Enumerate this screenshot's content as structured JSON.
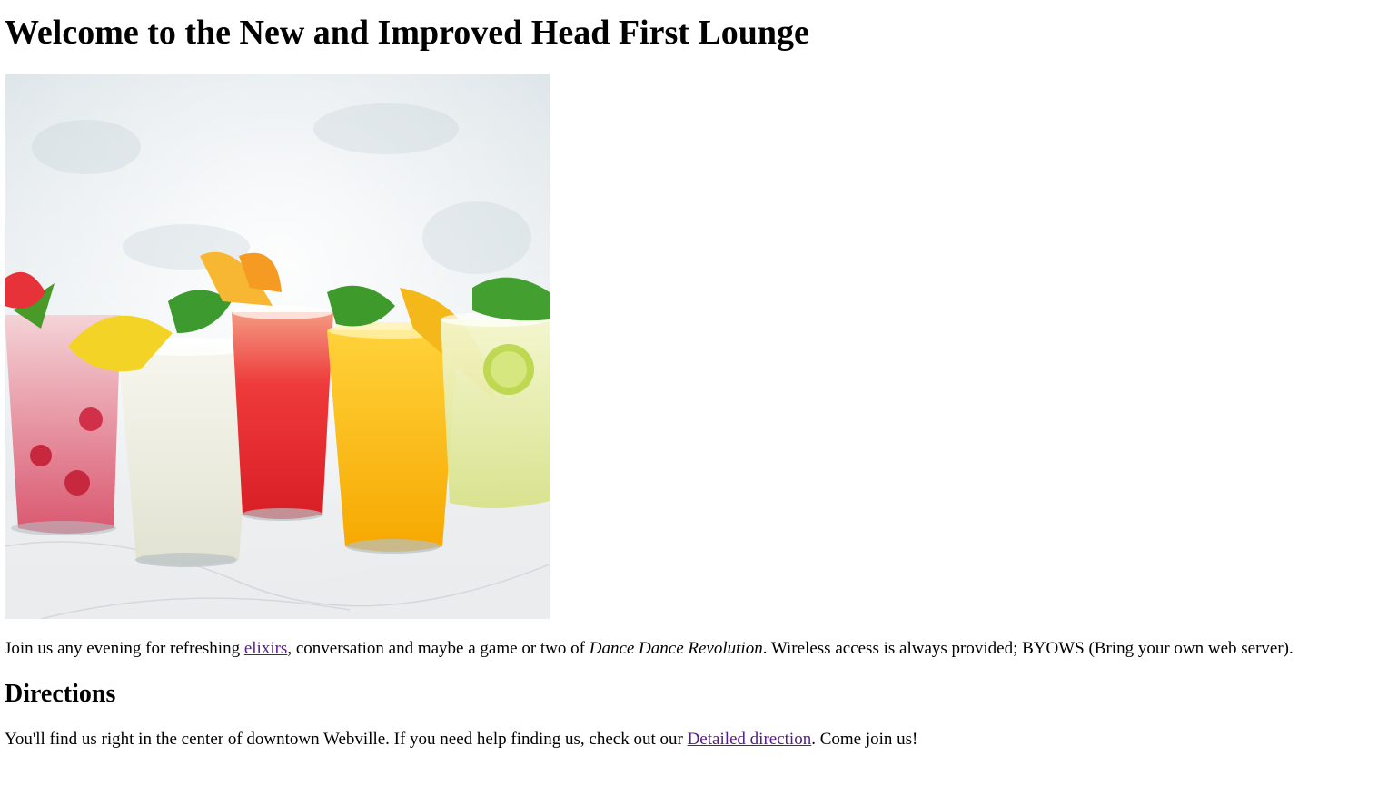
{
  "page": {
    "heading": "Welcome to the New and Improved Head First Lounge",
    "image": {
      "alt": "Five colorful drinks with fruit garnishes"
    },
    "intro": {
      "text_before_link": "Join us any evening for refreshing ",
      "link_text": "elixirs",
      "text_after_link": ", conversation and maybe a game or two of ",
      "emphasis": "Dance Dance Revolution",
      "text_end": ". Wireless access is always provided; BYOWS (Bring your own web server)."
    },
    "directions": {
      "heading": "Directions",
      "text_before_link": "You'll find us right in the center of downtown Webville. If you need help finding us, check out our ",
      "link_text": "Detailed direction",
      "text_end": ". Come join us!"
    },
    "colors": {
      "visited_link": "#551a8b",
      "text": "#000000",
      "background": "#ffffff"
    }
  }
}
